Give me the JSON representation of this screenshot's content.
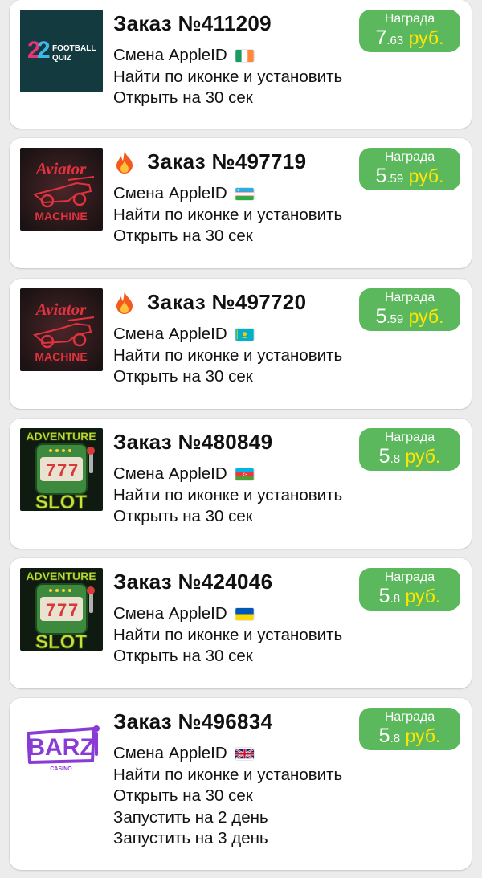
{
  "orders": [
    {
      "title": "Заказ №411209",
      "hot": false,
      "app_icon": "football-quiz-icon",
      "steps": [
        "Смена AppleID",
        "Найти по иконке и установить",
        "Открыть на 30 сек"
      ],
      "flag": "ireland-flag-icon",
      "reward_label": "Награда",
      "reward_int": "7",
      "reward_frac": ".63",
      "reward_currency": " руб."
    },
    {
      "title": "Заказ №497719",
      "hot": true,
      "app_icon": "aviator-machine-icon",
      "steps": [
        "Смена AppleID",
        "Найти по иконке и установить",
        "Открыть на 30 сек"
      ],
      "flag": "uzbekistan-flag-icon",
      "reward_label": "Награда",
      "reward_int": "5",
      "reward_frac": ".59",
      "reward_currency": " руб."
    },
    {
      "title": "Заказ №497720",
      "hot": true,
      "app_icon": "aviator-machine-icon",
      "steps": [
        "Смена AppleID",
        "Найти по иконке и установить",
        "Открыть на 30 сек"
      ],
      "flag": "kazakhstan-flag-icon",
      "reward_label": "Награда",
      "reward_int": "5",
      "reward_frac": ".59",
      "reward_currency": " руб."
    },
    {
      "title": "Заказ №480849",
      "hot": false,
      "app_icon": "adventure-slot-icon",
      "steps": [
        "Смена AppleID",
        "Найти по иконке и установить",
        "Открыть на 30 сек"
      ],
      "flag": "azerbaijan-flag-icon",
      "reward_label": "Награда",
      "reward_int": "5",
      "reward_frac": ".8",
      "reward_currency": " руб."
    },
    {
      "title": "Заказ №424046",
      "hot": false,
      "app_icon": "adventure-slot-icon",
      "steps": [
        "Смена AppleID",
        "Найти по иконке и установить",
        "Открыть на 30 сек"
      ],
      "flag": "ukraine-flag-icon",
      "reward_label": "Награда",
      "reward_int": "5",
      "reward_frac": ".8",
      "reward_currency": " руб."
    },
    {
      "title": "Заказ №496834",
      "hot": false,
      "app_icon": "barz-casino-icon",
      "steps": [
        "Смена AppleID",
        "Найти по иконке и установить",
        "Открыть на 30 сек",
        "Запустить на 2 день",
        "Запустить на 3 день"
      ],
      "flag": "uk-flag-icon",
      "reward_label": "Награда",
      "reward_int": "5",
      "reward_frac": ".8",
      "reward_currency": " руб."
    }
  ],
  "logo_text": {
    "football_quiz": [
      "FOOTBALL",
      "QUIZ"
    ],
    "aviator": [
      "Aviator",
      "MACHINE"
    ],
    "adventure_slot": [
      "ADVENTURE",
      "SLOT"
    ],
    "barz": [
      "BARZ",
      "CASINO"
    ]
  }
}
